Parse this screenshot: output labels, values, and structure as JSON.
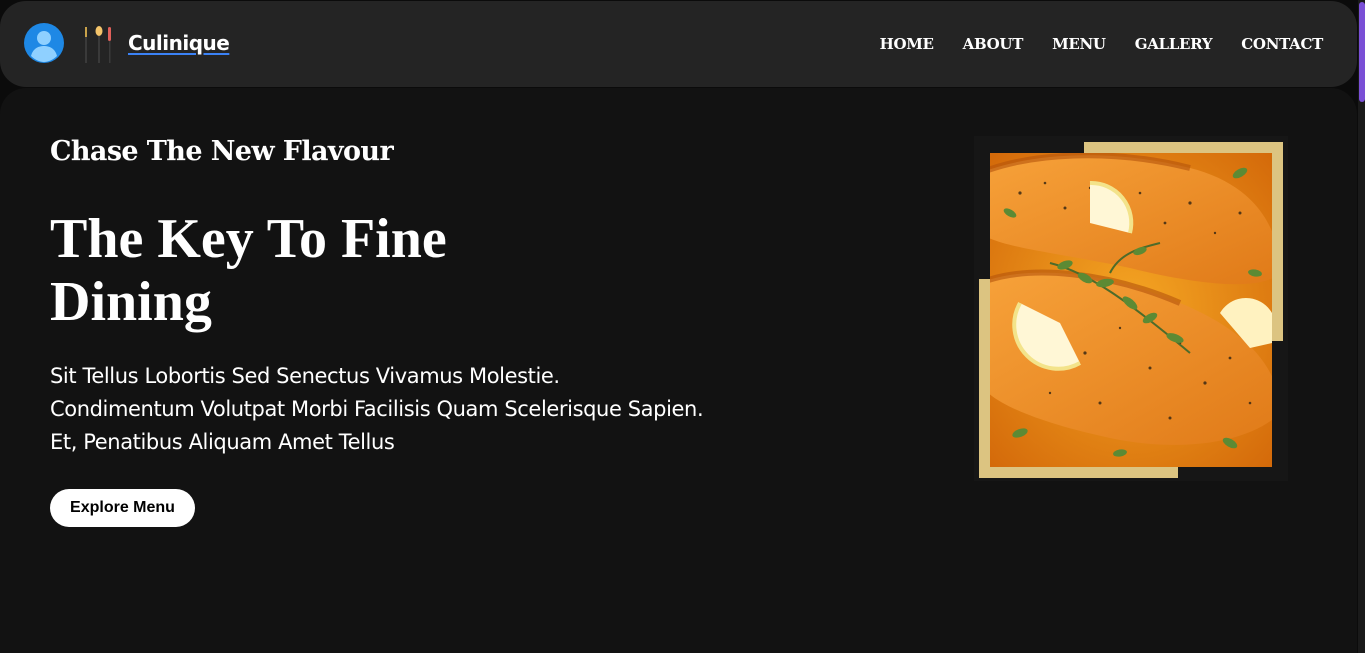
{
  "brand": {
    "name": "Culinique",
    "avatar_icon": "user-avatar-icon",
    "logo_icon": "cutlery-icon"
  },
  "nav": {
    "items": [
      {
        "label": "HOME"
      },
      {
        "label": "ABOUT"
      },
      {
        "label": "MENU"
      },
      {
        "label": "GALLERY"
      },
      {
        "label": "CONTACT"
      }
    ]
  },
  "hero": {
    "kicker": "Chase The New Flavour",
    "headline": "The Key To Fine Dining",
    "description": "Sit Tellus Lobortis Sed Senectus Vivamus Molestie. Condimentum Volutpat Morbi Facilisis Quam Scelerisque Sapien. Et, Penatibus Aliquam Amet Tellus",
    "cta_label": "Explore Menu"
  },
  "colors": {
    "nav_background": "#242424",
    "hero_background": "#121212",
    "frame_accent": "#dcc481",
    "avatar_blue": "#1e88e5",
    "scroll_thumb": "#7a4fd6"
  }
}
